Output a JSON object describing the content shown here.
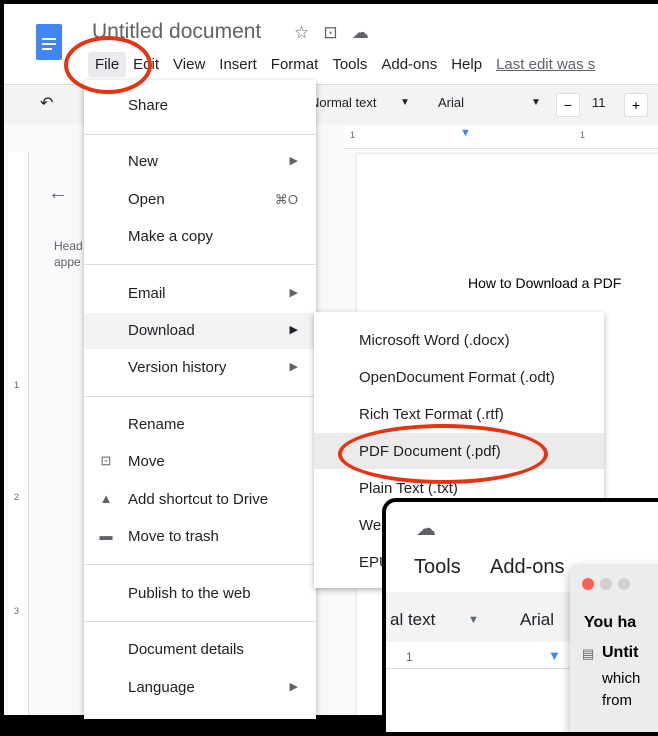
{
  "doc": {
    "title": "Untitled document",
    "body_text": "How to Download a PDF"
  },
  "menubar": [
    "File",
    "Edit",
    "View",
    "Insert",
    "Format",
    "Tools",
    "Add-ons",
    "Help"
  ],
  "last_edit": "Last edit was s",
  "toolbar": {
    "style": "Normal text",
    "font": "Arial",
    "size": "11",
    "minus": "−",
    "plus": "+"
  },
  "outline": {
    "line1": "Head",
    "line2": "appe"
  },
  "file_menu": [
    {
      "label": "Share"
    },
    {
      "label": "New",
      "arrow": "▶"
    },
    {
      "label": "Open",
      "shortcut": "⌘O"
    },
    {
      "label": "Make a copy"
    },
    {
      "label": "Email",
      "arrow": "▶"
    },
    {
      "label": "Download",
      "arrow": "▶"
    },
    {
      "label": "Version history",
      "arrow": "▶"
    },
    {
      "label": "Rename"
    },
    {
      "label": "Move",
      "icon": "folder-move-icon"
    },
    {
      "label": "Add shortcut to Drive",
      "icon": "drive-shortcut-icon"
    },
    {
      "label": "Move to trash",
      "icon": "trash-icon"
    },
    {
      "label": "Publish to the web"
    },
    {
      "label": "Document details"
    },
    {
      "label": "Language",
      "arrow": "▶"
    }
  ],
  "download_menu": [
    "Microsoft Word (.docx)",
    "OpenDocument Format (.odt)",
    "Rich Text Format (.rtf)",
    "PDF Document (.pdf)",
    "Plain Text (.txt)",
    "Web",
    "EPUB"
  ],
  "inset": {
    "menubar": [
      "Tools",
      "Add-ons"
    ],
    "style": "al text",
    "font": "Arial",
    "dialog_title": "You ha",
    "dialog_file": "Untit",
    "dialog_line1": "which",
    "dialog_line2": "from"
  },
  "colors": {
    "highlight_circle": "#e63312",
    "docs_blue": "#4285f4"
  }
}
